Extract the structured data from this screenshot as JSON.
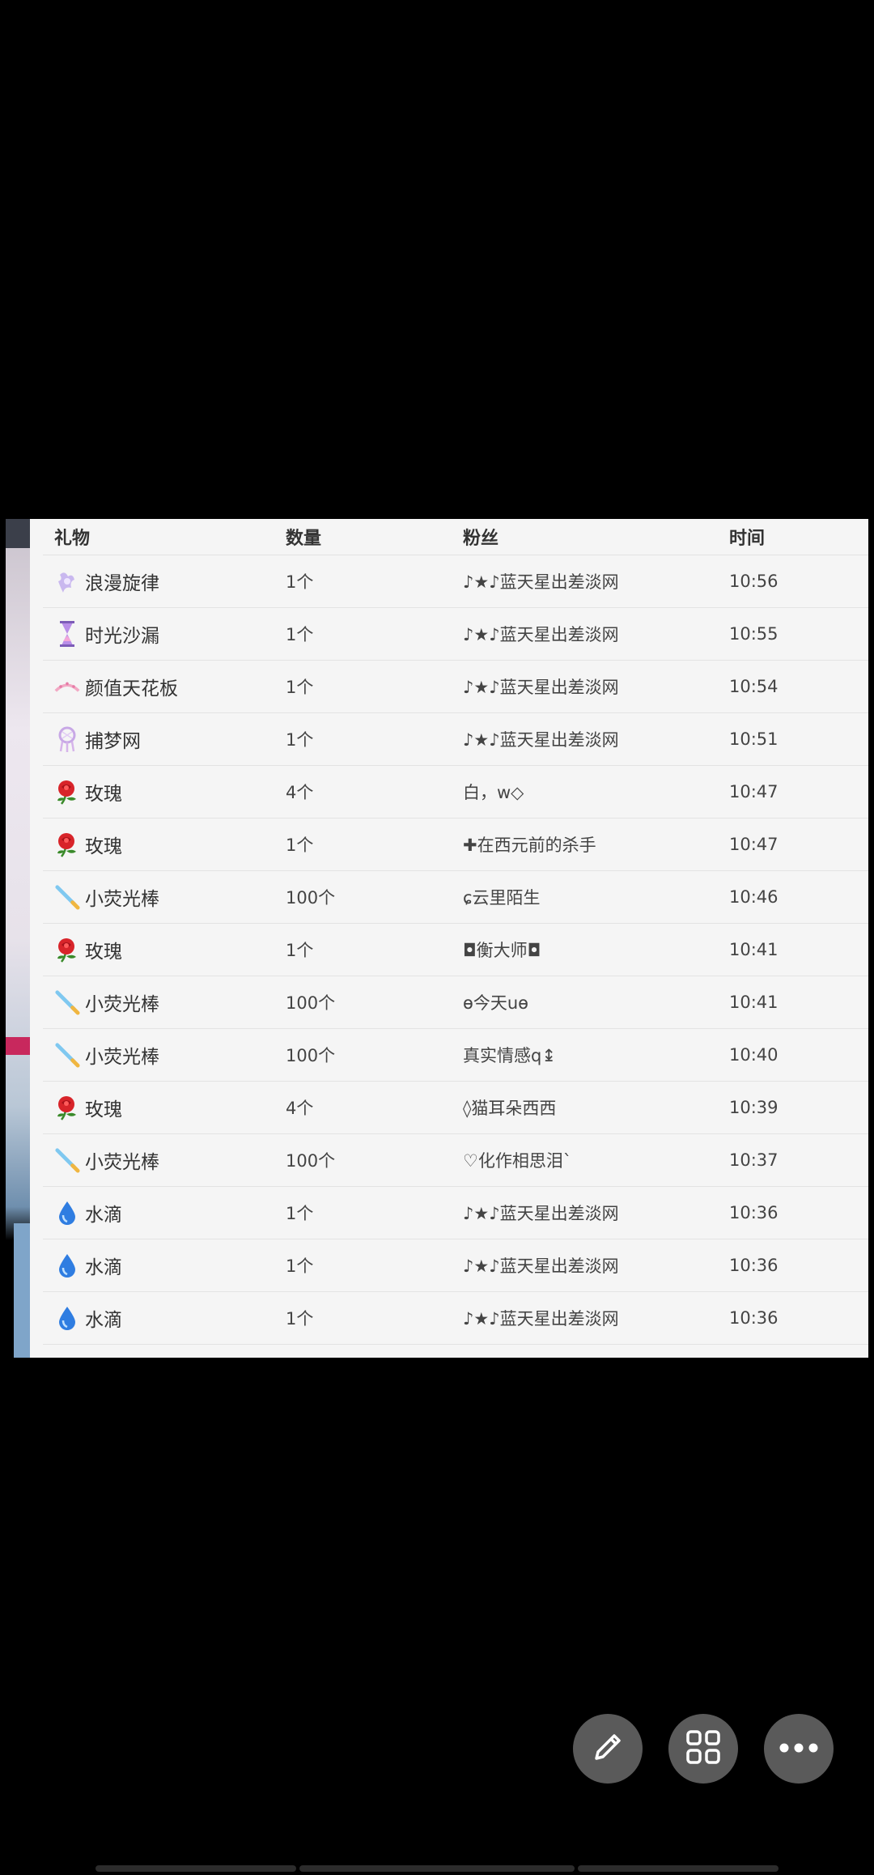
{
  "table": {
    "headers": {
      "gift": "礼物",
      "quantity": "数量",
      "fan": "粉丝",
      "time": "时间"
    },
    "rows": [
      {
        "gift": "浪漫旋律",
        "icon": "melody-icon",
        "quantity": "1个",
        "fan": "♪★♪蓝天星出差淡网",
        "time": "10:56"
      },
      {
        "gift": "时光沙漏",
        "icon": "hourglass-icon",
        "quantity": "1个",
        "fan": "♪★♪蓝天星出差淡网",
        "time": "10:55"
      },
      {
        "gift": "颜值天花板",
        "icon": "ceiling-icon",
        "quantity": "1个",
        "fan": "♪★♪蓝天星出差淡网",
        "time": "10:54"
      },
      {
        "gift": "捕梦网",
        "icon": "dreamcatcher-icon",
        "quantity": "1个",
        "fan": "♪★♪蓝天星出差淡网",
        "time": "10:51"
      },
      {
        "gift": "玫瑰",
        "icon": "rose-icon",
        "quantity": "4个",
        "fan": "白，w◇",
        "time": "10:47"
      },
      {
        "gift": "玫瑰",
        "icon": "rose-icon",
        "quantity": "1个",
        "fan": "✚在西元前的杀手",
        "time": "10:47"
      },
      {
        "gift": "小荧光棒",
        "icon": "glowstick-icon",
        "quantity": "100个",
        "fan": "ɕ云里陌生",
        "time": "10:46"
      },
      {
        "gift": "玫瑰",
        "icon": "rose-icon",
        "quantity": "1个",
        "fan": "◘衡大师◘",
        "time": "10:41"
      },
      {
        "gift": "小荧光棒",
        "icon": "glowstick-icon",
        "quantity": "100个",
        "fan": "ɵ今天uɵ",
        "time": "10:41"
      },
      {
        "gift": "小荧光棒",
        "icon": "glowstick-icon",
        "quantity": "100个",
        "fan": "真实情感q↨",
        "time": "10:40"
      },
      {
        "gift": "玫瑰",
        "icon": "rose-icon",
        "quantity": "4个",
        "fan": "◊猫耳朵西西",
        "time": "10:39"
      },
      {
        "gift": "小荧光棒",
        "icon": "glowstick-icon",
        "quantity": "100个",
        "fan": "♡化作相思泪`",
        "time": "10:37"
      },
      {
        "gift": "水滴",
        "icon": "water-drop-icon",
        "quantity": "1个",
        "fan": "♪★♪蓝天星出差淡网",
        "time": "10:36"
      },
      {
        "gift": "水滴",
        "icon": "water-drop-icon",
        "quantity": "1个",
        "fan": "♪★♪蓝天星出差淡网",
        "time": "10:36"
      },
      {
        "gift": "水滴",
        "icon": "water-drop-icon",
        "quantity": "1个",
        "fan": "♪★♪蓝天星出差淡网",
        "time": "10:36"
      }
    ]
  },
  "actions": {
    "edit_icon": "pencil-icon",
    "apps_icon": "grid-icon",
    "more_icon": "more-dots-icon"
  },
  "colors": {
    "background": "#000000",
    "table_bg": "#f5f5f5",
    "fab_bg": "#5a5a5a",
    "rose": "#d8242a",
    "water": "#2f7de1",
    "glow": "#7fc8f0"
  }
}
